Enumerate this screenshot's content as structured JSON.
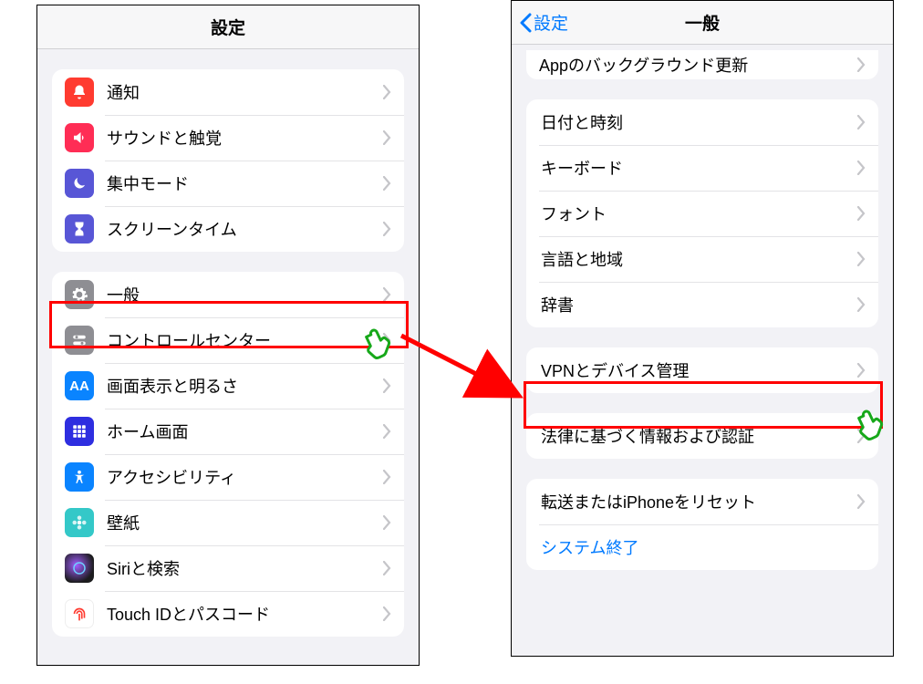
{
  "left": {
    "title": "設定",
    "items_group1": [
      {
        "icon": "bell",
        "bg": "#ff3b30",
        "label": "通知"
      },
      {
        "icon": "speaker",
        "bg": "#ff2d55",
        "label": "サウンドと触覚"
      },
      {
        "icon": "moon",
        "bg": "#5856d6",
        "label": "集中モード"
      },
      {
        "icon": "hourglass",
        "bg": "#5856d6",
        "label": "スクリーンタイム"
      }
    ],
    "items_group2": [
      {
        "icon": "gear",
        "bg": "#8e8e93",
        "label": "一般",
        "highlight": true
      },
      {
        "icon": "switches",
        "bg": "#8e8e93",
        "label": "コントロールセンター"
      },
      {
        "icon": "aa",
        "bg": "#0a84ff",
        "label": "画面表示と明るさ"
      },
      {
        "icon": "grid",
        "bg": "#3a3adf",
        "label": "ホーム画面"
      },
      {
        "icon": "person",
        "bg": "#0a84ff",
        "label": "アクセシビリティ"
      },
      {
        "icon": "flower",
        "bg": "#34c8c8",
        "label": "壁紙"
      },
      {
        "icon": "siri",
        "bg": "#1c1c1e",
        "label": "Siriと検索"
      },
      {
        "icon": "touchid",
        "bg": "#ff3b30",
        "label": "Touch IDとパスコード"
      }
    ]
  },
  "right": {
    "back_label": "設定",
    "title": "一般",
    "partial_top_label": "Appのバックグラウンド更新",
    "group1": [
      {
        "label": "日付と時刻"
      },
      {
        "label": "キーボード"
      },
      {
        "label": "フォント"
      },
      {
        "label": "言語と地域"
      },
      {
        "label": "辞書"
      }
    ],
    "group2": [
      {
        "label": "VPNとデバイス管理",
        "highlight": true
      }
    ],
    "group3": [
      {
        "label": "法律に基づく情報および認証"
      }
    ],
    "group4": [
      {
        "label": "転送またはiPhoneをリセット"
      },
      {
        "label": "システム終了",
        "blue": true,
        "no_chevron": true
      }
    ]
  }
}
